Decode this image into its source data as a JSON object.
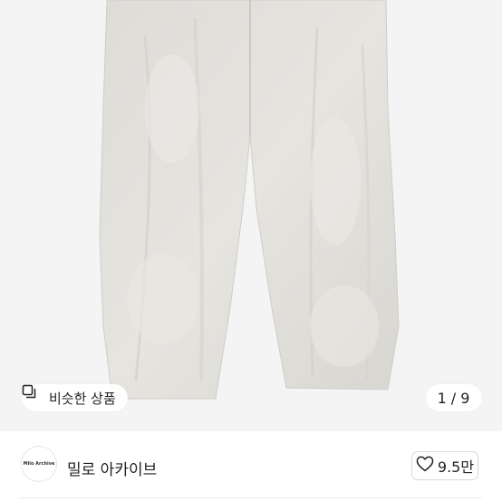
{
  "product": {
    "image_alt": "light grey wide pants",
    "similar_label": "비슷한 상품",
    "similar_icon": "similar-items-icon",
    "page_current": "1",
    "page_sep": "/",
    "page_total": "9"
  },
  "seller": {
    "avatar_text": "Milo Archive",
    "name": "밀로 아카이브"
  },
  "like": {
    "icon": "heart-outline-icon",
    "count": "9.5만"
  }
}
